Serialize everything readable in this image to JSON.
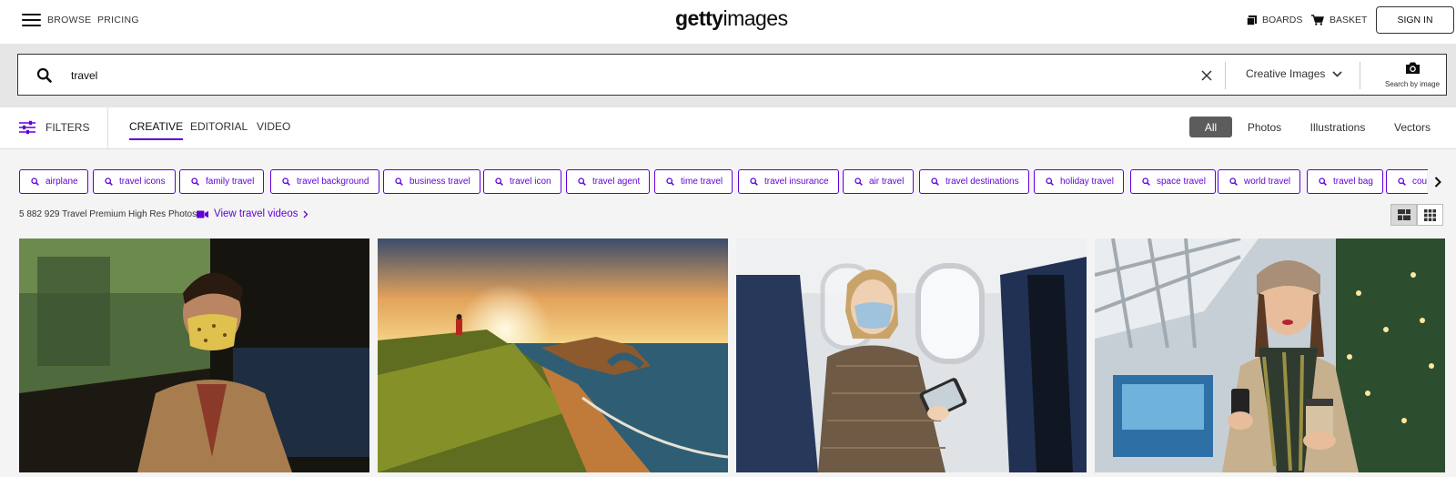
{
  "nav": {
    "browse": "BROWSE",
    "pricing": "PRICING",
    "logo_bold": "getty",
    "logo_light": "images",
    "boards": "BOARDS",
    "basket": "BASKET",
    "sign_in": "SIGN IN"
  },
  "search": {
    "query": "travel",
    "content_type": "Creative Images",
    "search_by_image": "Search by image"
  },
  "filters": {
    "label": "FILTERS",
    "tabs": [
      "CREATIVE",
      "EDITORIAL",
      "VIDEO"
    ],
    "active_tab": "CREATIVE",
    "media_types": [
      "All",
      "Photos",
      "Illustrations",
      "Vectors"
    ],
    "active_media": "All"
  },
  "keywords": [
    "airplane",
    "travel icons",
    "family travel",
    "travel background",
    "business travel",
    "travel icon",
    "travel agent",
    "time travel",
    "travel insurance",
    "air travel",
    "travel destinations",
    "holiday travel",
    "space travel",
    "world travel",
    "travel bag",
    "couple travel"
  ],
  "results": {
    "count_text": "5 882 929 Travel Premium High Res Photos",
    "view_videos": "View travel videos"
  },
  "colors": {
    "accent": "#5f00d9",
    "active_pill": "#5c5c5c"
  },
  "photos": [
    {
      "subject": "man-wearing-mask-on-train"
    },
    {
      "subject": "coastal-cliff-sunset-hiker"
    },
    {
      "subject": "woman-wearing-mask-on-airplane"
    },
    {
      "subject": "woman-with-phone-and-coffee-at-station"
    }
  ]
}
